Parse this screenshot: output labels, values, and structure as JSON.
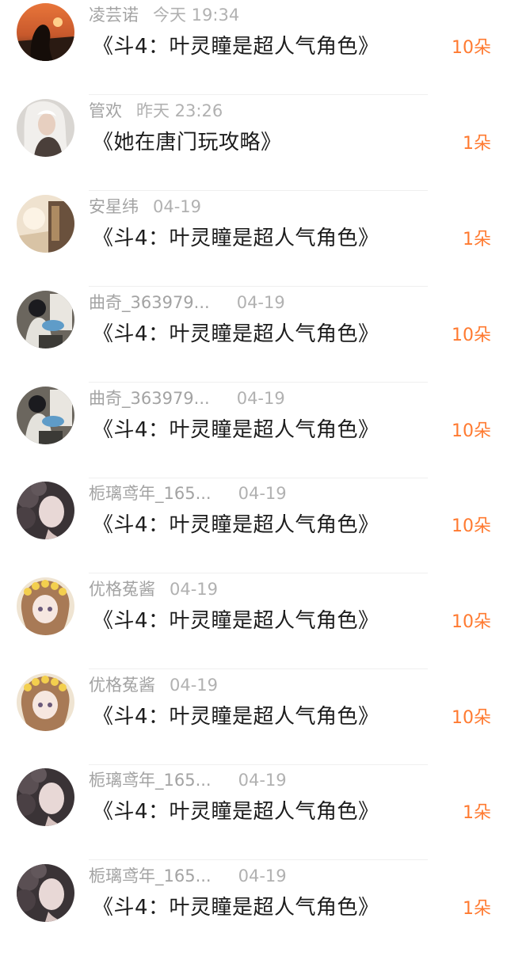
{
  "colors": {
    "name": "#a3a3a3",
    "title": "#1c1c1c",
    "gift": "#ff7a30",
    "divider": "#efefef"
  },
  "records": [
    {
      "name": "凌芸诺",
      "time": "今天 19:34",
      "title": "《斗4：叶灵瞳是超人气角色》",
      "gift": "10朵",
      "avatar_icon": "sunset-silhouette-avatar-icon"
    },
    {
      "name": "管欢",
      "time": "昨天 23:26",
      "title": "《她在唐门玩攻略》",
      "gift": "1朵",
      "avatar_icon": "white-haired-anime-avatar-icon"
    },
    {
      "name": "安星纬",
      "time": "04-19",
      "title": "《斗4：叶灵瞳是超人气角色》",
      "gift": "1朵",
      "avatar_icon": "room-light-avatar-icon"
    },
    {
      "name": "曲奇_363979...",
      "time": "04-19",
      "title": "《斗4：叶灵瞳是超人气角色》",
      "gift": "10朵",
      "avatar_icon": "painter-girl-avatar-icon"
    },
    {
      "name": "曲奇_363979...",
      "time": "04-19",
      "title": "《斗4：叶灵瞳是超人气角色》",
      "gift": "10朵",
      "avatar_icon": "painter-girl-avatar-icon"
    },
    {
      "name": "栀璃鸢年_165...",
      "time": "04-19",
      "title": "《斗4：叶灵瞳是超人气角色》",
      "gift": "10朵",
      "avatar_icon": "dark-curly-hair-avatar-icon"
    },
    {
      "name": "优格菟酱",
      "time": "04-19",
      "title": "《斗4：叶灵瞳是超人气角色》",
      "gift": "10朵",
      "avatar_icon": "flower-crown-girl-avatar-icon"
    },
    {
      "name": "优格菟酱",
      "time": "04-19",
      "title": "《斗4：叶灵瞳是超人气角色》",
      "gift": "10朵",
      "avatar_icon": "flower-crown-girl-avatar-icon"
    },
    {
      "name": "栀璃鸢年_165...",
      "time": "04-19",
      "title": "《斗4：叶灵瞳是超人气角色》",
      "gift": "1朵",
      "avatar_icon": "dark-curly-hair-avatar-icon"
    },
    {
      "name": "栀璃鸢年_165...",
      "time": "04-19",
      "title": "《斗4：叶灵瞳是超人气角色》",
      "gift": "1朵",
      "avatar_icon": "dark-curly-hair-avatar-icon"
    }
  ]
}
